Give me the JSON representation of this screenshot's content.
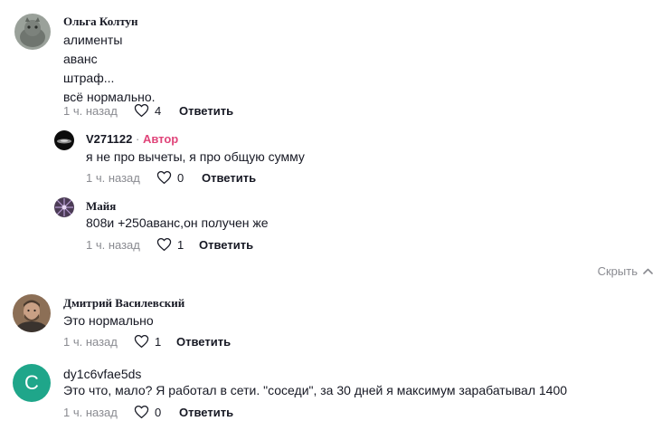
{
  "comments": [
    {
      "author": "Ольга Колтун",
      "lines": [
        "алименты",
        "аванс",
        "штраф...",
        "всё нормально."
      ],
      "time": "1 ч. назад",
      "likes": "4",
      "reply": "Ответить"
    },
    {
      "author": "V271122",
      "separator": "·",
      "badge": "Автор",
      "lines": [
        "я не про вычеты, я про общую сумму"
      ],
      "time": "1 ч. назад",
      "likes": "0",
      "reply": "Ответить"
    },
    {
      "author": "Майя",
      "lines": [
        "808и +250аванс,он получен же"
      ],
      "time": "1 ч. назад",
      "likes": "1",
      "reply": "Ответить"
    },
    {
      "author": "Дмитрий Василевский",
      "lines": [
        "Это нормально"
      ],
      "time": "1 ч. назад",
      "likes": "1",
      "reply": "Ответить"
    },
    {
      "author": "dy1c6vfae5ds",
      "avatar_letter": "C",
      "lines": [
        "Это что, мало? Я работал в сети. \"соседи\", за 30 дней я максимум зарабатывал 1400"
      ],
      "time": "1 ч. назад",
      "likes": "0",
      "reply": "Ответить"
    }
  ],
  "hide_replies": "Скрыть",
  "colors": {
    "badge": "#e0457a",
    "muted": "#8a8b91",
    "letter_avatar_bg": "#1fa68a"
  }
}
